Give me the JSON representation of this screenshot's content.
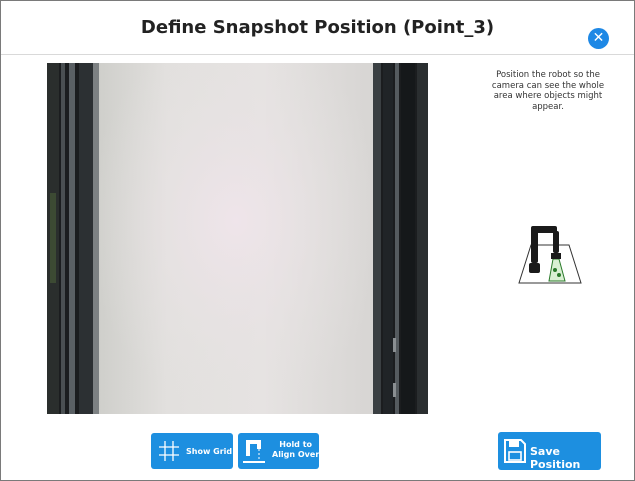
{
  "dialog": {
    "title": "Define Snapshot Position (Point_3)",
    "close_icon": "close-icon",
    "instructions": "Position the robot so the camera can see the whole area where objects might appear."
  },
  "camera_view": {
    "icon": "camera-feed"
  },
  "buttons": {
    "show_grid": {
      "label": "Show Grid",
      "icon": "grid-icon"
    },
    "align": {
      "label": "Hold to\nAlign Over",
      "icon": "align-over-icon"
    },
    "save_position": {
      "label": "Save Position",
      "icon": "save-disk-icon"
    }
  },
  "colors": {
    "accent": "#1d8fe0",
    "close": "#1e88e5"
  }
}
